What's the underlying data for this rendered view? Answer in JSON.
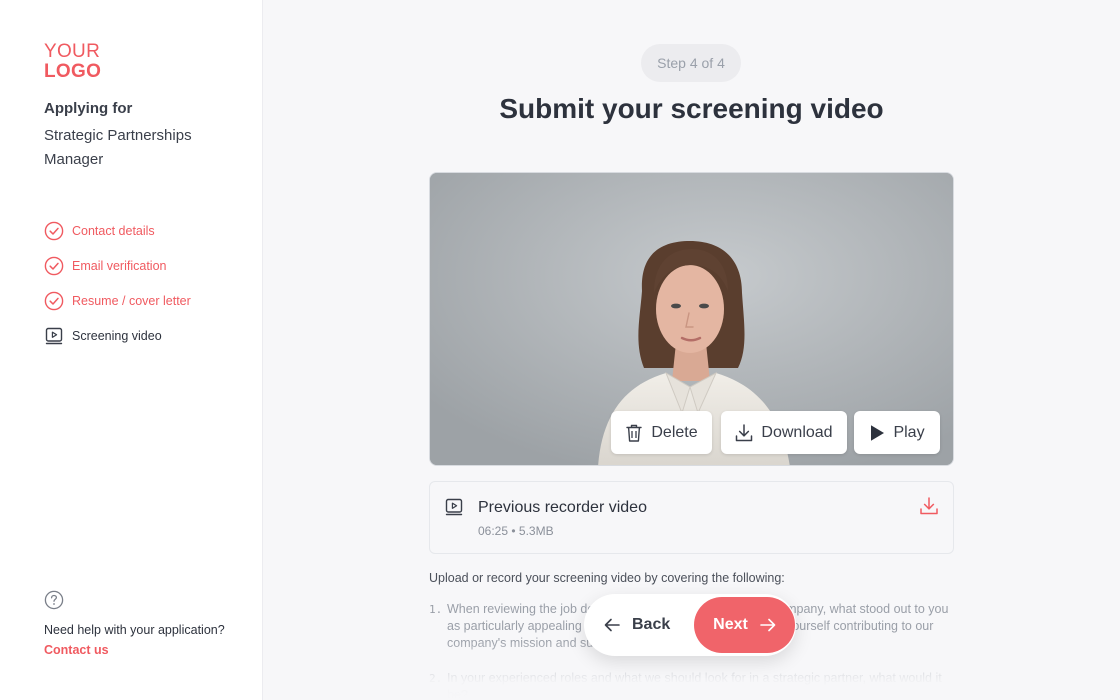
{
  "logo": {
    "line1": "YOUR",
    "line2": "LOGO"
  },
  "sidebar": {
    "applying_label": "Applying for",
    "role": "Strategic Partnerships Manager",
    "steps": [
      {
        "label": "Contact details",
        "status": "done",
        "icon": "check-circle-icon"
      },
      {
        "label": "Email verification",
        "status": "done",
        "icon": "check-circle-icon"
      },
      {
        "label": "Resume / cover letter",
        "status": "done",
        "icon": "check-circle-icon"
      },
      {
        "label": "Screening video",
        "status": "current",
        "icon": "video-icon"
      }
    ],
    "help_text": "Need help with your application?",
    "contact_link": "Contact us"
  },
  "main": {
    "step_indicator": "Step 4 of 4",
    "title": "Submit your screening video",
    "video_buttons": {
      "delete": "Delete",
      "download": "Download",
      "play": "Play"
    },
    "previous": {
      "title": "Previous recorder video",
      "meta": "06:25 • 5.3MB"
    },
    "instructions": "Upload or record your screening video by covering the following:",
    "questions": [
      {
        "num": "1.",
        "text": "When reviewing the job description and learning about our company, what stood out to you as particularly appealing about this role, and how do you see yourself contributing to our company's mission and success?"
      },
      {
        "num": "2.",
        "text": "In your experienced roles and what we should look for in a strategic partner, what would it be?"
      }
    ],
    "nav": {
      "back": "Back",
      "next": "Next"
    }
  },
  "colors": {
    "accent": "#f05a60",
    "next_button": "#f0646a",
    "background": "#f7f7f9",
    "text": "#2d323d"
  }
}
